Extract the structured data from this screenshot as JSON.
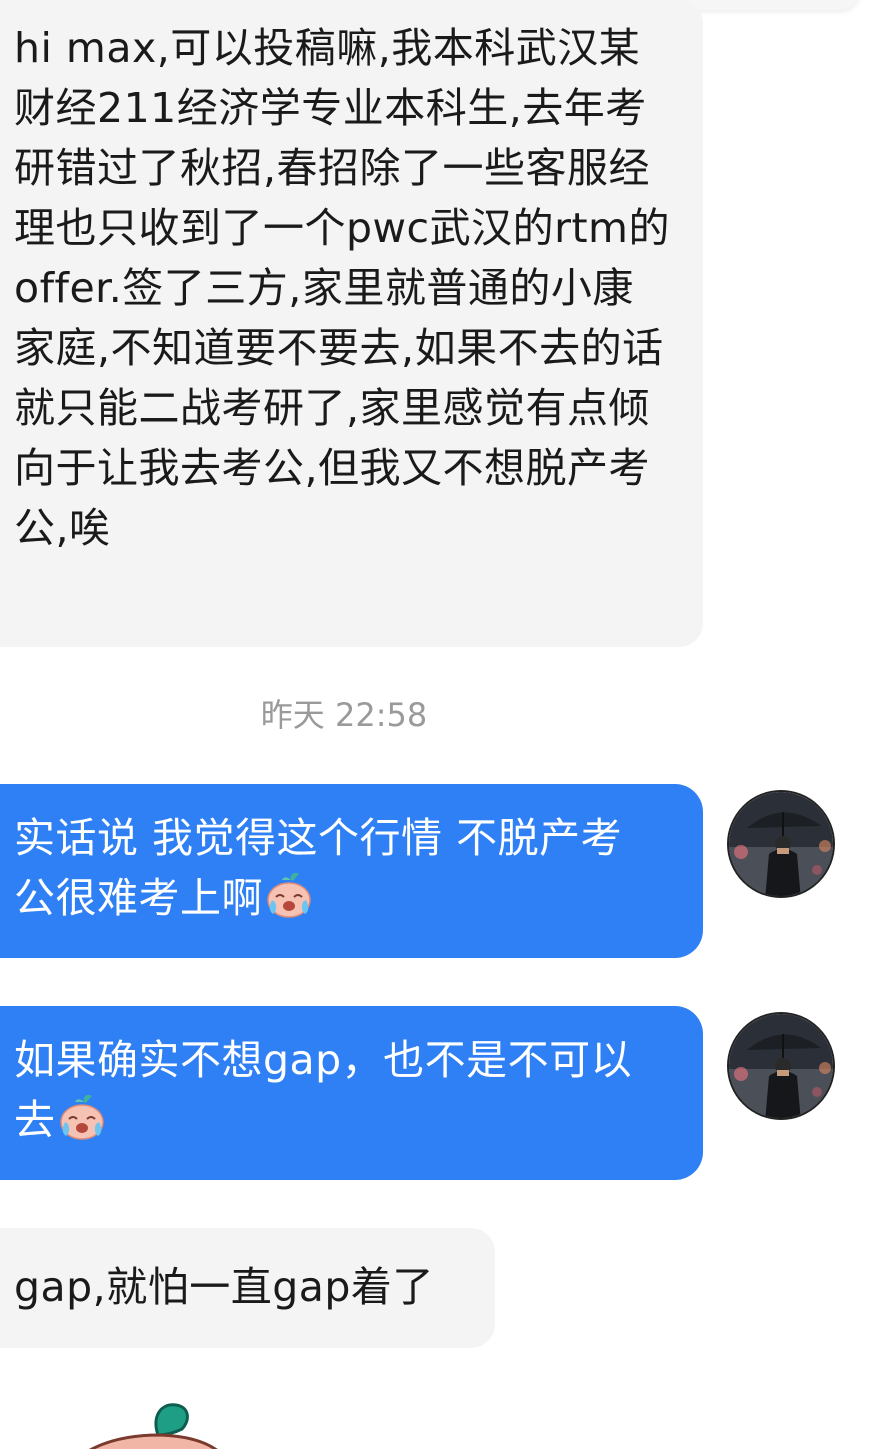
{
  "conversation": {
    "messages": [
      {
        "sender": "other",
        "text": "hi max,可以投稿嘛,我本科武汉某财经211经济学专业本科生,去年考研错过了秋招,春招除了一些客服经理也只收到了一个pwc武汉的rtm的offer.签了三方,家里就普通的小康家庭,不知道要不要去,如果不去的话就只能二战考研了,家里感觉有点倾向于让我去考公,但我又不想脱产考公,唉"
      },
      {
        "sender": "me",
        "text": "实话说 我觉得这个行情 不脱产考公很难考上啊",
        "emoji": "crying-face-sticker"
      },
      {
        "sender": "me",
        "text": "如果确实不想gap，也不是不可以去",
        "emoji": "crying-face-sticker"
      },
      {
        "sender": "other",
        "text": "gap,就怕一直gap着了"
      }
    ],
    "timestamp": "昨天 22:58"
  },
  "colors": {
    "outgoing_bubble": "#2f80f5",
    "incoming_bubble": "#f4f4f4",
    "timestamp_text": "#9a9a9a"
  },
  "icons": {
    "avatar": "man-with-umbrella-avatar",
    "sticker": "crying-radish-sticker"
  }
}
